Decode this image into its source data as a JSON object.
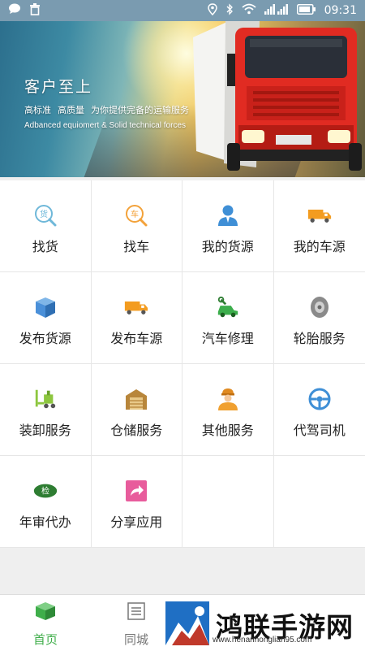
{
  "status_bar": {
    "time": "09:31",
    "icons": [
      "chat-icon",
      "trash-icon",
      "location-icon",
      "bluetooth-icon",
      "wifi-icon",
      "signal-icon",
      "battery-icon"
    ]
  },
  "banner": {
    "headline": "客户至上",
    "sub1": "高标准",
    "sub2": "高质量",
    "sub3": "为你提供完备的运输服务",
    "english": "Adbanced equiomert & Solid technical forces"
  },
  "grid": [
    {
      "label": "找货",
      "icon": "search-goods-icon",
      "color": "#6fb8d9"
    },
    {
      "label": "找车",
      "icon": "search-truck-icon",
      "color": "#f3a23a"
    },
    {
      "label": "我的货源",
      "icon": "person-icon",
      "color": "#3f8fd6"
    },
    {
      "label": "我的车源",
      "icon": "truck-icon",
      "color": "#f39c20"
    },
    {
      "label": "发布货源",
      "icon": "box-icon",
      "color": "#4a90d9"
    },
    {
      "label": "发布车源",
      "icon": "truck-icon",
      "color": "#f39c20"
    },
    {
      "label": "汽车修理",
      "icon": "car-repair-icon",
      "color": "#3cae4c"
    },
    {
      "label": "轮胎服务",
      "icon": "tire-icon",
      "color": "#8a8a8a"
    },
    {
      "label": "装卸服务",
      "icon": "forklift-icon",
      "color": "#8dc63f"
    },
    {
      "label": "仓储服务",
      "icon": "warehouse-icon",
      "color": "#b8863b"
    },
    {
      "label": "其他服务",
      "icon": "worker-icon",
      "color": "#f0a030"
    },
    {
      "label": "代驾司机",
      "icon": "steering-wheel-icon",
      "color": "#3f8fd6"
    },
    {
      "label": "年审代办",
      "icon": "inspection-badge-icon",
      "color": "#2e7d32",
      "badge_text": "检"
    },
    {
      "label": "分享应用",
      "icon": "share-icon",
      "color": "#e85c9c"
    }
  ],
  "tabbar": {
    "home_label": "首页",
    "city_label": "同城"
  },
  "watermark": {
    "title": "鸿联手游网",
    "url": "www.henanhonglian95.com"
  }
}
